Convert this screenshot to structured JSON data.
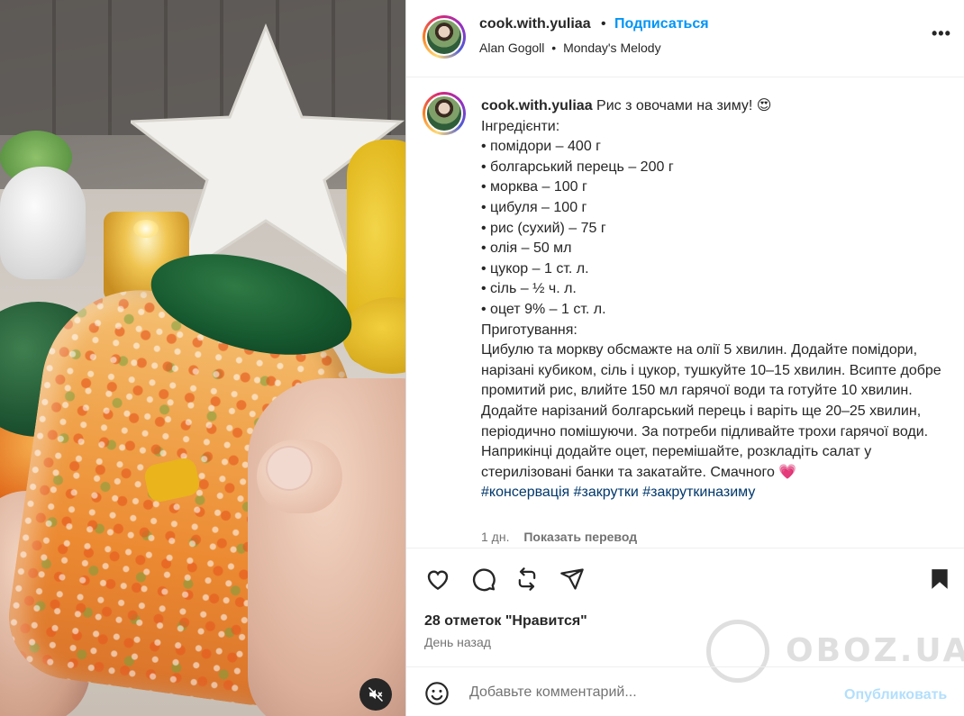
{
  "header": {
    "username": "cook.with.yuliaa",
    "separator": "•",
    "follow_label": "Подписаться",
    "audio_artist": "Alan Gogoll",
    "audio_separator": "•",
    "audio_track": "Monday's Melody",
    "more_label": "•••"
  },
  "caption": {
    "username": "cook.with.yuliaa",
    "title": "Рис з овочами на зиму! 😍",
    "ingredients_heading": "Інгредієнти:",
    "ingredients": [
      "• помідори – 400 г",
      "• болгарський перець – 200 г",
      "• морква – 100 г",
      "• цибуля – 100 г",
      "• рис (сухий) – 75 г",
      "• олія – 50 мл",
      "• цукор – 1 ст. л.",
      "• сіль – ½ ч. л.",
      "• оцет 9% – 1 ст. л."
    ],
    "method_heading": "Приготування:",
    "method_text": "Цибулю та моркву обсмажте на олії 5 хвилин. Додайте помідори, нарізані кубиком, сіль і цукор, тушкуйте 10–15 хвилин. Всипте добре промитий рис, влийте 150 мл гарячої води та готуйте 10 хвилин. Додайте нарізаний болгарський перець і варіть ще 20–25 хвилин, періодично помішуючи. За потреби підливайте трохи гарячої води. Наприкінці додайте оцет, перемішайте, розкладіть салат у стерилізовані банки та закатайте. Смачного 💗",
    "hashtags": "#консервація #закрутки #закруткиназиму",
    "age": "1 дн.",
    "translate_label": "Показать перевод"
  },
  "actions": {
    "icons": [
      "heart-icon",
      "comment-icon",
      "repost-icon",
      "share-icon",
      "bookmark-icon"
    ]
  },
  "stats": {
    "likes": "28 отметок \"Нравится\"",
    "time": "День назад"
  },
  "comment": {
    "placeholder": "Добавьте комментарий...",
    "publish_label": "Опубликовать"
  },
  "watermark": {
    "text": "OBOZ.UA"
  },
  "colors": {
    "accent": "#0095f6",
    "link": "#00376b",
    "publish_disabled": "#b2dffc",
    "lid_green": "#175a30"
  }
}
